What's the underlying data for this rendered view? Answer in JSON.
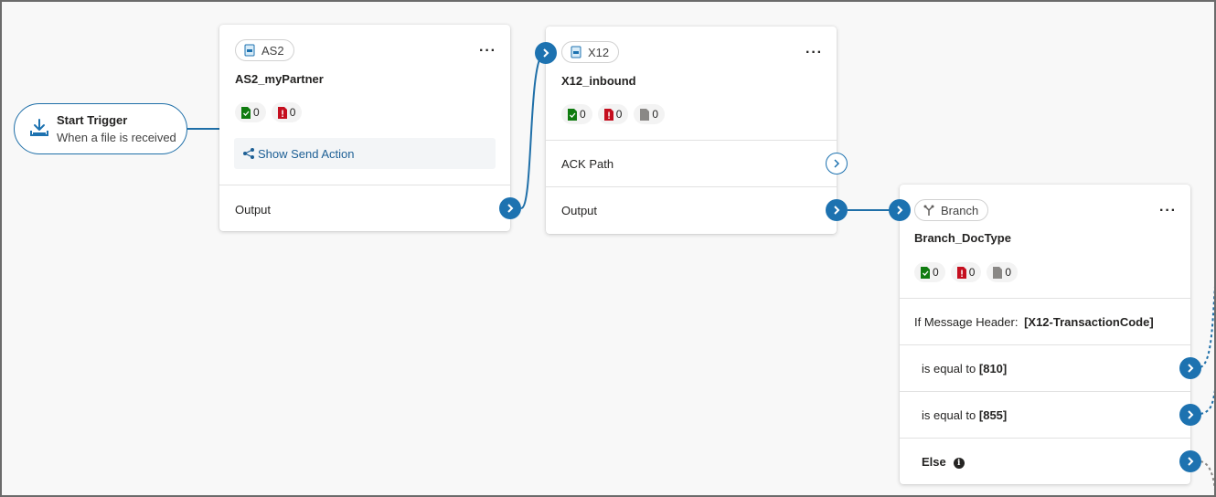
{
  "trigger": {
    "title": "Start Trigger",
    "subtitle": "When a file is received",
    "icon": "download-icon"
  },
  "as2_card": {
    "chip_label": "AS2",
    "name": "AS2_myPartner",
    "stats": [
      {
        "kind": "success",
        "count": "0",
        "color": "#107c10"
      },
      {
        "kind": "error",
        "count": "0",
        "color": "#c50f1f"
      }
    ],
    "send_action_label": "Show Send Action",
    "output_label": "Output"
  },
  "x12_card": {
    "chip_label": "X12",
    "name": "X12_inbound",
    "stats": [
      {
        "kind": "success",
        "count": "0",
        "color": "#107c10"
      },
      {
        "kind": "error",
        "count": "0",
        "color": "#c50f1f"
      },
      {
        "kind": "other",
        "count": "0",
        "color": "#8a8886"
      }
    ],
    "ack_label": "ACK Path",
    "output_label": "Output"
  },
  "branch_card": {
    "chip_label": "Branch",
    "name": "Branch_DocType",
    "stats": [
      {
        "kind": "success",
        "count": "0",
        "color": "#107c10"
      },
      {
        "kind": "error",
        "count": "0",
        "color": "#c50f1f"
      },
      {
        "kind": "other",
        "count": "0",
        "color": "#8a8886"
      }
    ],
    "condition_prefix": "If Message Header:",
    "condition_field": "[X12-TransactionCode]",
    "cases": [
      {
        "prefix": "is equal to",
        "value": "[810]"
      },
      {
        "prefix": "is equal to",
        "value": "[855]"
      }
    ],
    "else_label": "Else"
  },
  "colors": {
    "accent": "#1d72b0",
    "wire": "#1f6fa8",
    "canvas": "#f8f8f8"
  }
}
